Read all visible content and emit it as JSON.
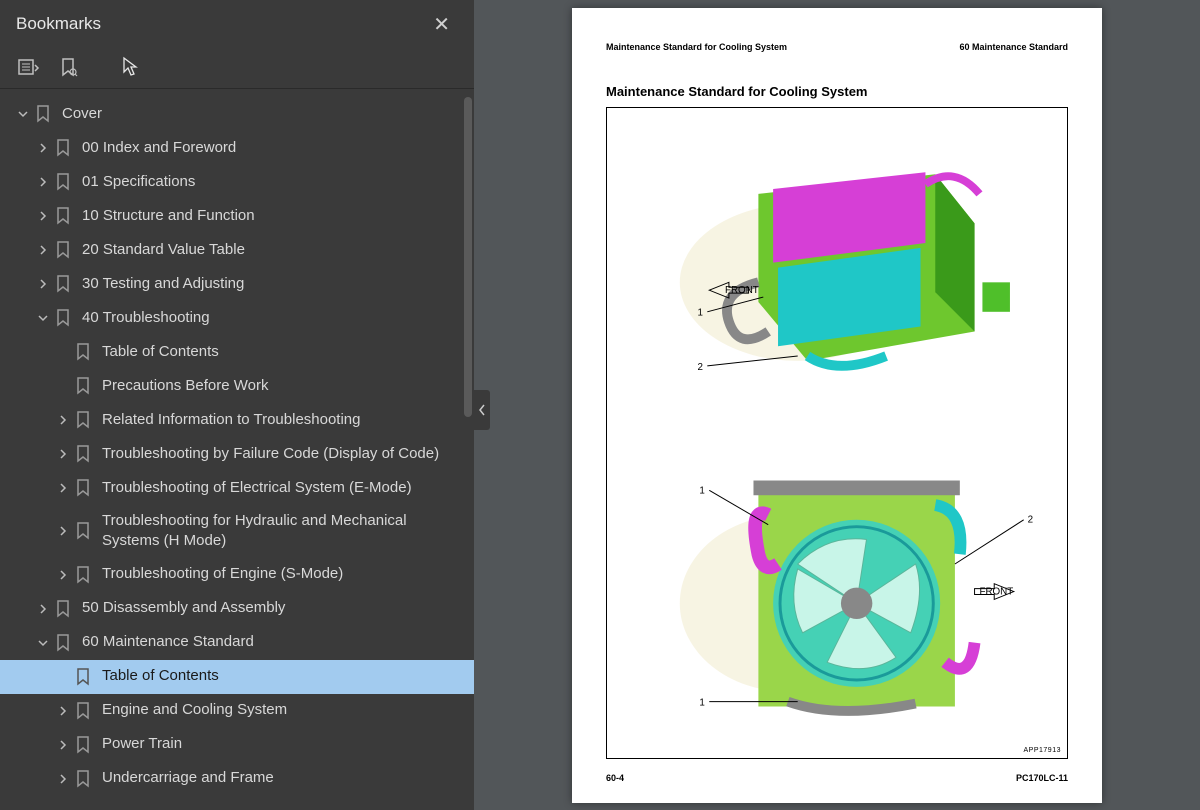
{
  "sidebar": {
    "title": "Bookmarks",
    "tree": {
      "root": {
        "label": "Cover",
        "expanded": true
      },
      "items": [
        {
          "label": "00 Index and Foreword",
          "hasChildren": true,
          "expanded": false,
          "indent": 1
        },
        {
          "label": "01 Specifications",
          "hasChildren": true,
          "expanded": false,
          "indent": 1
        },
        {
          "label": "10 Structure and Function",
          "hasChildren": true,
          "expanded": false,
          "indent": 1
        },
        {
          "label": "20 Standard Value Table",
          "hasChildren": true,
          "expanded": false,
          "indent": 1
        },
        {
          "label": "30 Testing and Adjusting",
          "hasChildren": true,
          "expanded": false,
          "indent": 1
        },
        {
          "label": "40 Troubleshooting",
          "hasChildren": true,
          "expanded": true,
          "indent": 1
        },
        {
          "label": "Table of Contents",
          "hasChildren": false,
          "indent": 2
        },
        {
          "label": "Precautions Before Work",
          "hasChildren": false,
          "indent": 2
        },
        {
          "label": "Related Information to Troubleshooting",
          "hasChildren": true,
          "expanded": false,
          "indent": 2
        },
        {
          "label": "Troubleshooting by Failure Code (Display of Code)",
          "hasChildren": true,
          "expanded": false,
          "indent": 2
        },
        {
          "label": "Troubleshooting of Electrical System (E-Mode)",
          "hasChildren": true,
          "expanded": false,
          "indent": 2
        },
        {
          "label": "Troubleshooting for Hydraulic and Mechanical Systems (H Mode)",
          "hasChildren": true,
          "expanded": false,
          "indent": 2
        },
        {
          "label": "Troubleshooting of Engine (S-Mode)",
          "hasChildren": true,
          "expanded": false,
          "indent": 2
        },
        {
          "label": "50 Disassembly and Assembly",
          "hasChildren": true,
          "expanded": false,
          "indent": 1
        },
        {
          "label": "60 Maintenance Standard",
          "hasChildren": true,
          "expanded": true,
          "indent": 1
        },
        {
          "label": "Table of Contents",
          "hasChildren": false,
          "indent": 2,
          "selected": true
        },
        {
          "label": "Engine and Cooling System",
          "hasChildren": true,
          "expanded": false,
          "indent": 2
        },
        {
          "label": "Power Train",
          "hasChildren": true,
          "expanded": false,
          "indent": 2
        },
        {
          "label": "Undercarriage and Frame",
          "hasChildren": true,
          "expanded": false,
          "indent": 2
        }
      ]
    }
  },
  "page": {
    "header_left": "Maintenance Standard for Cooling System",
    "header_right": "60 Maintenance Standard",
    "title": "Maintenance Standard for Cooling System",
    "figure_id": "APP17913",
    "figure_callouts": {
      "top": [
        "1",
        "2"
      ],
      "bottom": [
        "1",
        "1",
        "2"
      ],
      "front_label": "FRONT"
    },
    "footer_left": "60-4",
    "footer_right": "PC170LC-11"
  }
}
